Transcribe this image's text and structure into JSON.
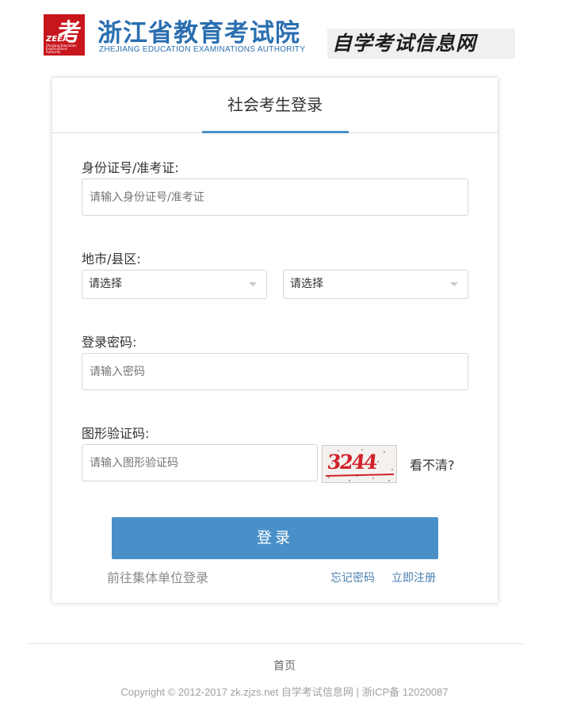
{
  "header": {
    "logo_glyph": "考",
    "logo_abbr": "ZEEA",
    "logo_sub": "Zhejiang Education Examinations Authority",
    "org_name": "浙江省教育考试院",
    "org_name_en": "ZHEJIANG EDUCATION EXAMINATIONS AUTHORITY",
    "site_name": "自学考试信息网"
  },
  "login": {
    "title": "社会考生登录",
    "id_label": "身份证号/准考证:",
    "id_placeholder": "请输入身份证号/准考证",
    "region_label": "地市/县区:",
    "city_select": "请选择",
    "county_select": "请选择",
    "password_label": "登录密码:",
    "password_placeholder": "请输入密码",
    "captcha_label": "图形验证码:",
    "captcha_placeholder": "请输入图形验证码",
    "captcha_text": "3244",
    "refresh_label": "看不清?",
    "submit_label": "登录",
    "group_login_label": "前往集体单位登录",
    "forgot_label": "忘记密码",
    "register_label": "立即注册"
  },
  "footer": {
    "home_label": "首页",
    "copyright": "Copyright © 2012-2017 zk.zjzs.net 自学考试信息网   |   浙ICP备 12020087"
  },
  "colors": {
    "accent": "#4a90c8",
    "brand_red": "#c8161d",
    "org_blue": "#2a6fb0",
    "link": "#4a7fb0"
  }
}
